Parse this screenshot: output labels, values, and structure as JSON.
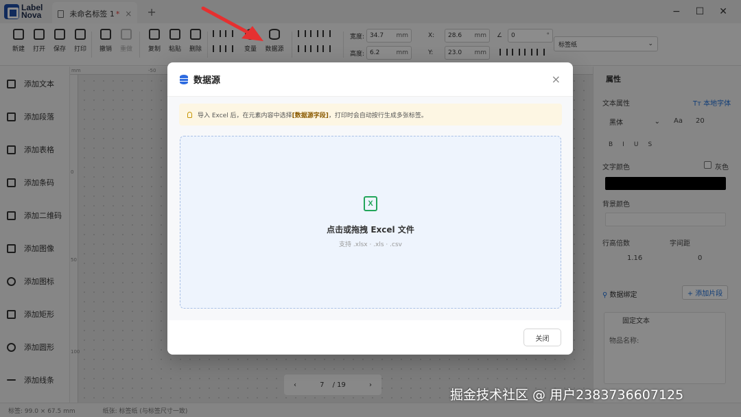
{
  "app": {
    "logo_line1": "Label",
    "logo_line2": "Nova",
    "tab_title": "未命名标签 1",
    "tab_dirty_mark": "*",
    "tab_close": "×",
    "add_tab": "+",
    "window_controls": [
      "−",
      "☐",
      "✕"
    ]
  },
  "toolbar": {
    "new": "新建",
    "open": "打开",
    "save": "保存",
    "print": "打印",
    "undo": "撤销",
    "redo": "重做",
    "copy": "复制",
    "paste": "粘贴",
    "delete": "删除",
    "variable": "变量",
    "datasource": "数据源",
    "width_label": "宽度:",
    "width_value": "34.7",
    "height_label": "高度:",
    "height_value": "6.2",
    "x_label": "X:",
    "x_value": "28.6",
    "y_label": "Y:",
    "y_value": "23.0",
    "unit": "mm",
    "angle_label": "∠",
    "angle_value": "0",
    "angle_unit": "°",
    "paper_select": "标签纸"
  },
  "left_items": [
    "添加文本",
    "添加段落",
    "添加表格",
    "添加条码",
    "添加二维码",
    "添加图像",
    "添加图标",
    "添加矩形",
    "添加圆形",
    "添加线条"
  ],
  "ruler": {
    "top_unit": "mm",
    "top_mark": "-50",
    "left_mark_1": "0",
    "left_mark_2": "50",
    "left_mark_3": "100"
  },
  "pager": {
    "prev": "‹",
    "current": "7",
    "total": "/ 19",
    "next": "›"
  },
  "right_panel": {
    "title": "属性",
    "text_props": "文本属性",
    "local_font": "Tт 本地字体",
    "font_family": "黑体",
    "font_size_icon": "Aa",
    "font_size": "20",
    "style_buttons": [
      "B",
      "I",
      "U",
      "S"
    ],
    "text_color": "文字颜色",
    "gray_label": "灰色",
    "bg_color": "背景颜色",
    "line_height_label": "行高倍数",
    "line_height_value": "1.16",
    "letter_spacing_label": "字间距",
    "letter_spacing_value": "0",
    "data_binding": "数据绑定",
    "add_segment": "+ 添加片段",
    "fixed_text": "固定文本",
    "fixed_text_value": "物品名称:",
    "text_color_value": "#000000"
  },
  "status": {
    "label_size": "标签: 99.0 × 67.5 mm",
    "paper": "纸张: 标签纸 (与标签尺寸一致)"
  },
  "modal": {
    "title": "数据源",
    "close_icon": "×",
    "tip_prefix": "导入 Excel 后，在元素内容中选择 ",
    "tip_bold": "[数据源字段]",
    "tip_suffix": "，打印时会自动按行生成多张标签。",
    "excel_icon_letter": "X",
    "drop_title": "点击或拖拽 Excel 文件",
    "drop_sub": "支持 .xlsx · .xls · .csv",
    "close_button": "关闭"
  },
  "watermark": "掘金技术社区 @ 用户2383736607125",
  "colors": {
    "accent": "#2d6be0",
    "excel_green": "#22a55a",
    "annotation_red": "#e53030"
  }
}
